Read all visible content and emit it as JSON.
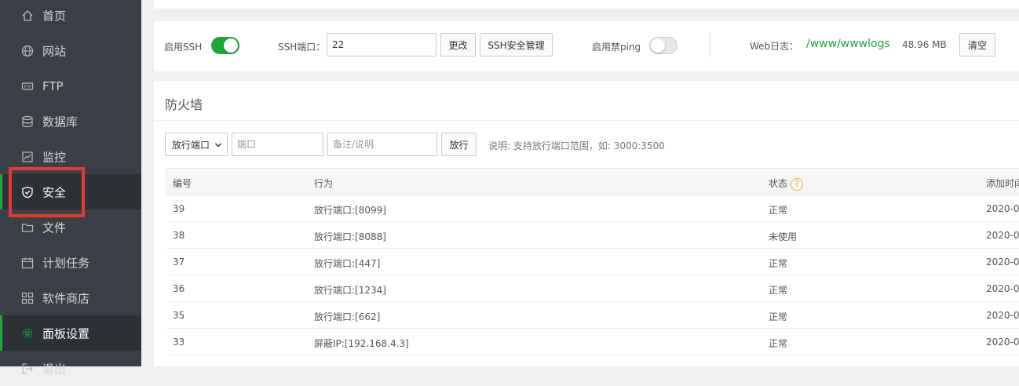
{
  "sidebar": {
    "items": [
      {
        "label": "首页",
        "icon": "home-icon"
      },
      {
        "label": "网站",
        "icon": "globe-icon"
      },
      {
        "label": "FTP",
        "icon": "ftp-icon"
      },
      {
        "label": "数据库",
        "icon": "database-icon"
      },
      {
        "label": "监控",
        "icon": "monitor-icon"
      },
      {
        "label": "安全",
        "icon": "shield-icon"
      },
      {
        "label": "文件",
        "icon": "folder-icon"
      },
      {
        "label": "计划任务",
        "icon": "calendar-icon"
      },
      {
        "label": "软件商店",
        "icon": "grid-icon"
      },
      {
        "label": "面板设置",
        "icon": "gear-icon"
      },
      {
        "label": "退出",
        "icon": "logout-icon"
      }
    ],
    "active_index": 5,
    "highlight_color": "#e53935"
  },
  "ssh": {
    "enable_label": "启用SSH",
    "enable_on": true,
    "port_label": "SSH端口：",
    "port_value": "22",
    "change_btn": "更改",
    "manage_btn": "SSH安全管理",
    "ping_label": "启用禁ping",
    "ping_on": false,
    "weblog_label": "Web日志：",
    "weblog_path": "/www/wwwlogs",
    "weblog_size": "48.96 MB",
    "clear_btn": "清空"
  },
  "firewall": {
    "title": "防火墙",
    "select_value": "放行端口",
    "port_placeholder": "端口",
    "note_placeholder": "备注/说明",
    "allow_btn": "放行",
    "hint": "说明: 支持放行端口范围，如: 3000:3500",
    "columns": {
      "id": "编号",
      "action": "行为",
      "status": "状态",
      "added": "添加时间"
    },
    "rows": [
      {
        "id": "39",
        "action": "放行端口:[8099]",
        "status": "正常",
        "added": "2020-0"
      },
      {
        "id": "38",
        "action": "放行端口:[8088]",
        "status": "未使用",
        "added": "2020-0"
      },
      {
        "id": "37",
        "action": "放行端口:[447]",
        "status": "正常",
        "added": "2020-0"
      },
      {
        "id": "36",
        "action": "放行端口:[1234]",
        "status": "正常",
        "added": "2020-0"
      },
      {
        "id": "35",
        "action": "放行端口:[662]",
        "status": "正常",
        "added": "2020-0"
      },
      {
        "id": "33",
        "action": "屏蔽IP:[192.168.4.3]",
        "status": "正常",
        "added": "2020-0"
      }
    ]
  },
  "colors": {
    "accent": "#20a53a",
    "sidebar_bg": "#3a3f45",
    "help": "#f0ad4e"
  }
}
